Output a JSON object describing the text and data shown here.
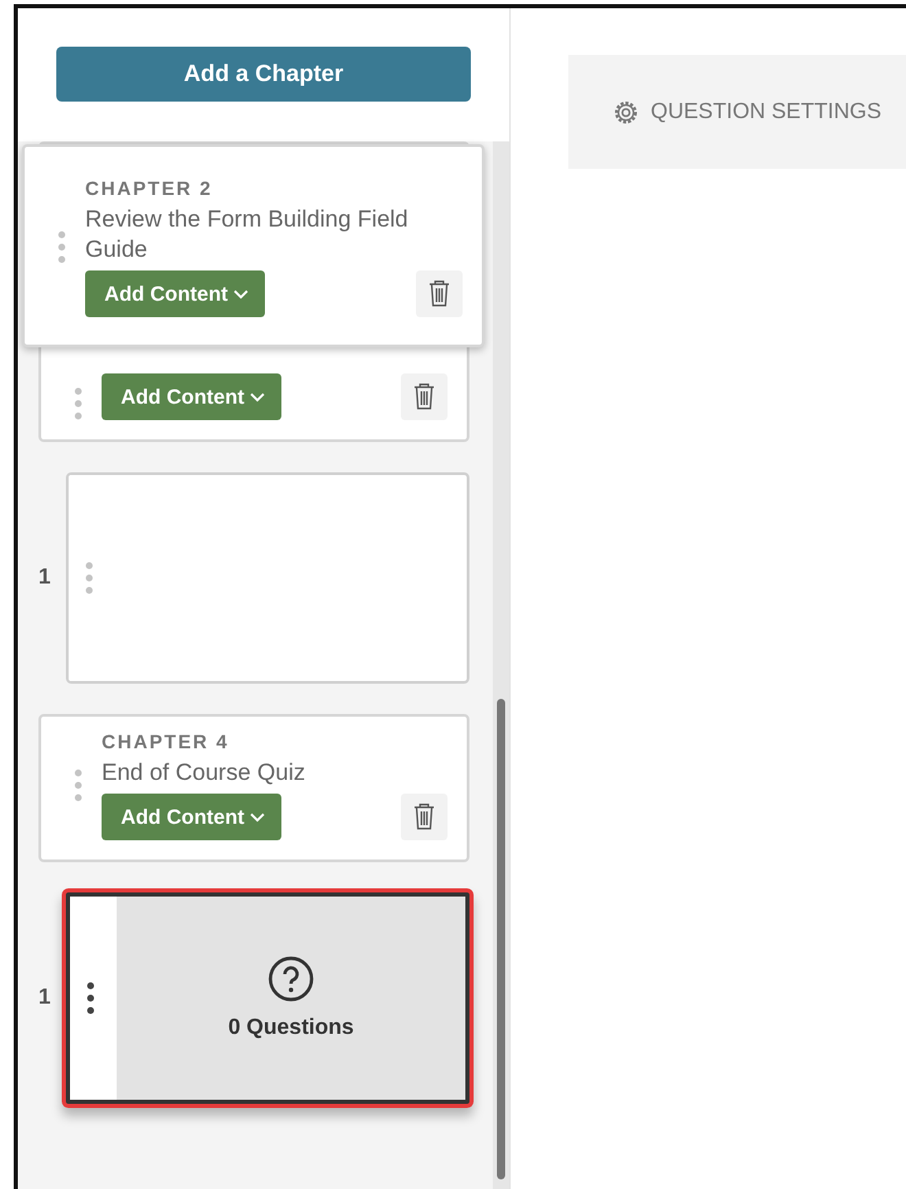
{
  "sidebar": {
    "add_chapter_button": "Add a Chapter",
    "items": [
      {
        "kind": "chapter",
        "button": "Add Content"
      },
      {
        "kind": "content",
        "number": "1",
        "selected": false
      },
      {
        "kind": "chapter",
        "label": "CHAPTER 4",
        "title": "End of Course Quiz",
        "button": "Add Content"
      },
      {
        "kind": "quiz",
        "number": "1",
        "count": "0 Questions",
        "selected": true
      }
    ],
    "dragged_item": {
      "label": "CHAPTER 2",
      "title": "Review the Form Building Field Guide",
      "button": "Add Content"
    }
  },
  "settings_tab": {
    "label": "QUESTION SETTINGS"
  }
}
